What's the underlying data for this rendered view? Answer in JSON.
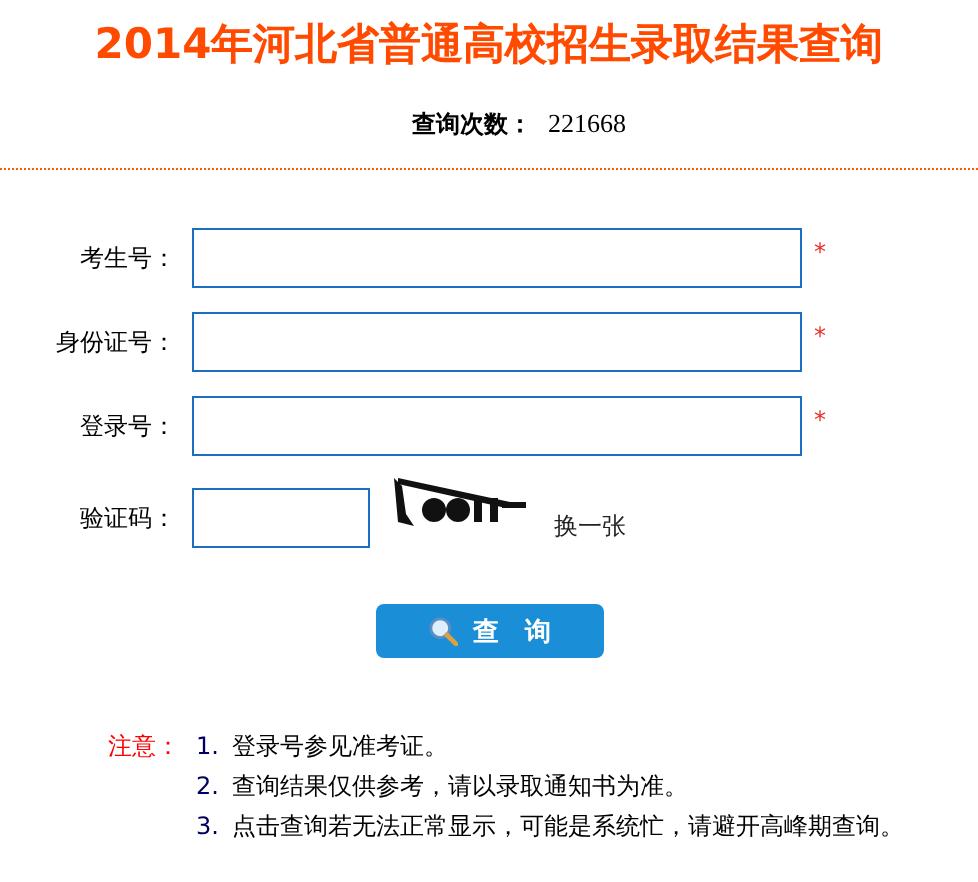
{
  "title": "2014年河北省普通高校招生录取结果查询",
  "query_count": {
    "label": "查询次数：",
    "value": "221668"
  },
  "fields": [
    {
      "label": "考生号：",
      "required_mark": "*",
      "kind": "text"
    },
    {
      "label": "身份证号：",
      "required_mark": "*",
      "kind": "text"
    },
    {
      "label": "登录号：",
      "required_mark": "*",
      "kind": "text"
    },
    {
      "label": "验证码：",
      "kind": "captcha",
      "refresh_link": "换一张"
    }
  ],
  "submit_button": "查　询",
  "notes": {
    "label": "注意：",
    "items": [
      {
        "number": "1.",
        "text": "登录号参见准考证。"
      },
      {
        "number": "2.",
        "text": "查询结果仅供参考，请以录取通知书为准。"
      },
      {
        "number": "3.",
        "text": "点击查询若无法正常显示，可能是系统忙，请避开高峰期查询。"
      }
    ]
  }
}
